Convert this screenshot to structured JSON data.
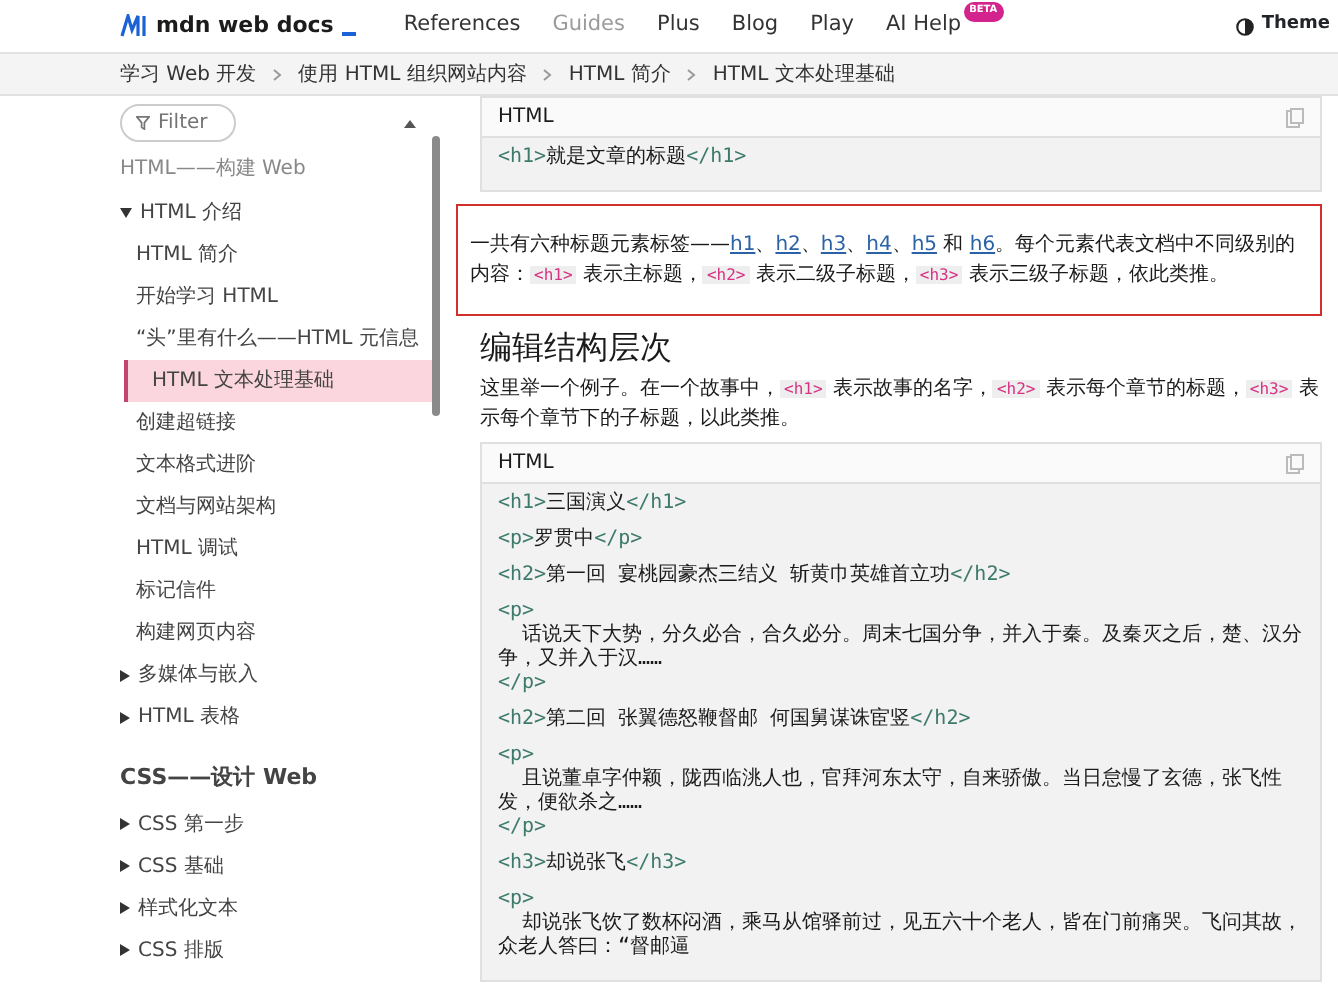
{
  "header": {
    "logo": "mdn web docs",
    "nav": [
      {
        "label": "References",
        "selected": false
      },
      {
        "label": "Guides",
        "selected": true
      },
      {
        "label": "Plus",
        "selected": false
      },
      {
        "label": "Blog",
        "selected": false
      },
      {
        "label": "Play",
        "selected": false
      },
      {
        "label": "AI Help",
        "selected": false,
        "badge": "BETA"
      }
    ],
    "theme_button": "Theme"
  },
  "breadcrumbs": [
    "学习 Web 开发",
    "使用 HTML 组织网站内容",
    "HTML 简介",
    "HTML 文本处理基础"
  ],
  "sidebar": {
    "filter_placeholder": "Filter",
    "sections": [
      {
        "title": "HTML——构建 Web",
        "children": [
          {
            "label": "HTML 介绍",
            "expanded": true,
            "children": [
              {
                "label": "HTML 简介",
                "selected": false
              },
              {
                "label": "开始学习 HTML",
                "selected": false
              },
              {
                "label": "“头”里有什么——HTML 元信息",
                "selected": false
              },
              {
                "label": "HTML 文本处理基础",
                "selected": true
              },
              {
                "label": "创建超链接",
                "selected": false
              },
              {
                "label": "文本格式进阶",
                "selected": false
              },
              {
                "label": "文档与网站架构",
                "selected": false
              },
              {
                "label": "HTML 调试",
                "selected": false
              },
              {
                "label": "标记信件",
                "selected": false
              },
              {
                "label": "构建网页内容",
                "selected": false
              }
            ]
          },
          {
            "label": "多媒体与嵌入",
            "expanded": false
          },
          {
            "label": "HTML 表格",
            "expanded": false
          }
        ]
      },
      {
        "title": "CSS——设计 Web",
        "children": [
          {
            "label": "CSS 第一步",
            "expanded": false
          },
          {
            "label": "CSS 基础",
            "expanded": false
          },
          {
            "label": "样式化文本",
            "expanded": false
          },
          {
            "label": "CSS 排版",
            "expanded": false
          }
        ]
      }
    ]
  },
  "content": [
    {
      "kind": "code",
      "language": "HTML",
      "blocks": [
        [
          "<h1>就是文章的标题</h1>"
        ]
      ]
    },
    {
      "kind": "paragraph",
      "highlighted": true,
      "parts": [
        {
          "kind": "text",
          "text": "一共有六种标题元素标签——"
        },
        {
          "kind": "link",
          "text": "h1"
        },
        {
          "kind": "text",
          "text": "、"
        },
        {
          "kind": "link",
          "text": "h2"
        },
        {
          "kind": "text",
          "text": "、"
        },
        {
          "kind": "link",
          "text": "h3"
        },
        {
          "kind": "text",
          "text": "、"
        },
        {
          "kind": "link",
          "text": "h4"
        },
        {
          "kind": "text",
          "text": "、"
        },
        {
          "kind": "link",
          "text": "h5"
        },
        {
          "kind": "text",
          "text": " 和 "
        },
        {
          "kind": "link",
          "text": "h6"
        },
        {
          "kind": "text",
          "text": "。每个元素代表文档中不同级别的内容："
        },
        {
          "kind": "code",
          "text": "<h1>"
        },
        {
          "kind": "text",
          "text": " 表示主标题，"
        },
        {
          "kind": "code",
          "text": "<h2>"
        },
        {
          "kind": "text",
          "text": " 表示二级子标题，"
        },
        {
          "kind": "code",
          "text": "<h3>"
        },
        {
          "kind": "text",
          "text": " 表示三级子标题，依此类推。"
        }
      ]
    },
    {
      "kind": "heading",
      "text": "编辑结构层次"
    },
    {
      "kind": "paragraph",
      "highlighted": false,
      "parts": [
        {
          "kind": "text",
          "text": "这里举一个例子。在一个故事中，"
        },
        {
          "kind": "code",
          "text": "<h1>"
        },
        {
          "kind": "text",
          "text": " 表示故事的名字，"
        },
        {
          "kind": "code",
          "text": "<h2>"
        },
        {
          "kind": "text",
          "text": " 表示每个章节的标题，"
        },
        {
          "kind": "code",
          "text": "<h3>"
        },
        {
          "kind": "text",
          "text": " 表示每个章节下的子标题，以此类推。"
        }
      ]
    },
    {
      "kind": "code",
      "language": "HTML",
      "blocks": [
        [
          "<h1>三国演义</h1>"
        ],
        [
          "<p>罗贯中</p>"
        ],
        [
          "<h2>第一回 宴桃园豪杰三结义 斩黄巾英雄首立功</h2>"
        ],
        [
          "<p>",
          "  话说天下大势，分久必合，合久必分。周末七国分争，并入于秦。及秦灭之后，楚、汉分争，又并入于汉……",
          "</p>"
        ],
        [
          "<h2>第二回 张翼德怒鞭督邮 何国舅谋诛宦竖</h2>"
        ],
        [
          "<p>",
          "  且说董卓字仲颖，陇西临洮人也，官拜河东太守，自来骄傲。当日怠慢了玄德，张飞性发，便欲杀之……",
          "</p>"
        ],
        [
          "<h3>却说张飞</h3>"
        ],
        [
          "<p>",
          "  却说张飞饮了数杯闷酒，乘马从馆驿前过，见五六十个老人，皆在门前痛哭。飞问其故，众老人答曰：“督邮逼"
        ]
      ]
    }
  ]
}
